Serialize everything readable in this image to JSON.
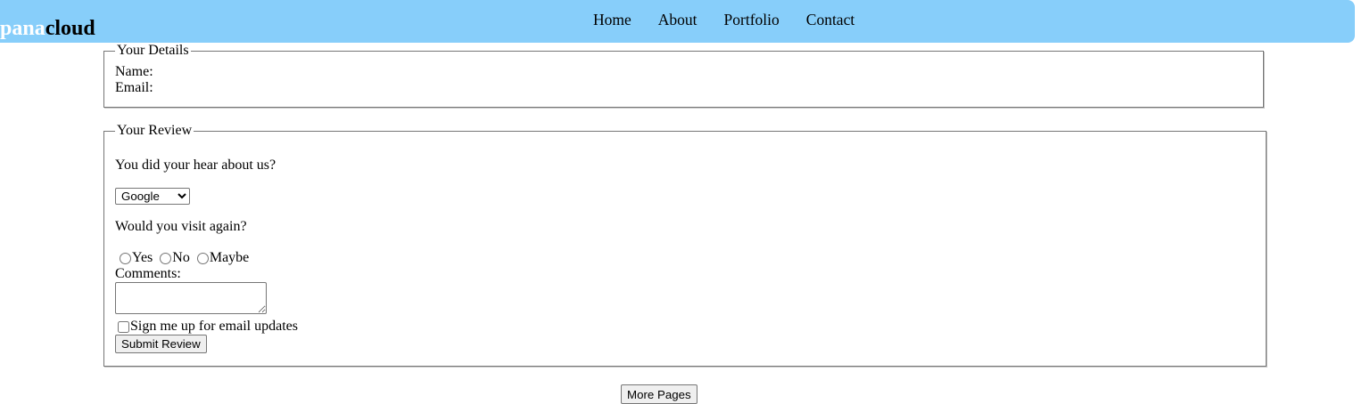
{
  "header": {
    "logo_part1": "pana",
    "logo_part2": "cloud",
    "nav": [
      "Home",
      "About",
      "Portfolio",
      "Contact"
    ],
    "background": "#87cefa"
  },
  "details": {
    "legend": "Your Details",
    "name_label": "Name:",
    "email_label": "Email:"
  },
  "review": {
    "legend": "Your Review",
    "question_source": "You did your hear about us?",
    "source_selected": "Google",
    "question_visit": "Would you visit again?",
    "radio_yes": "Yes",
    "radio_no": "No",
    "radio_maybe": "Maybe",
    "comments_label": "Comments:",
    "signup_label": "Sign me up for email updates",
    "submit_label": "Submit Review"
  },
  "footer": {
    "more_pages_label": "More Pages"
  }
}
